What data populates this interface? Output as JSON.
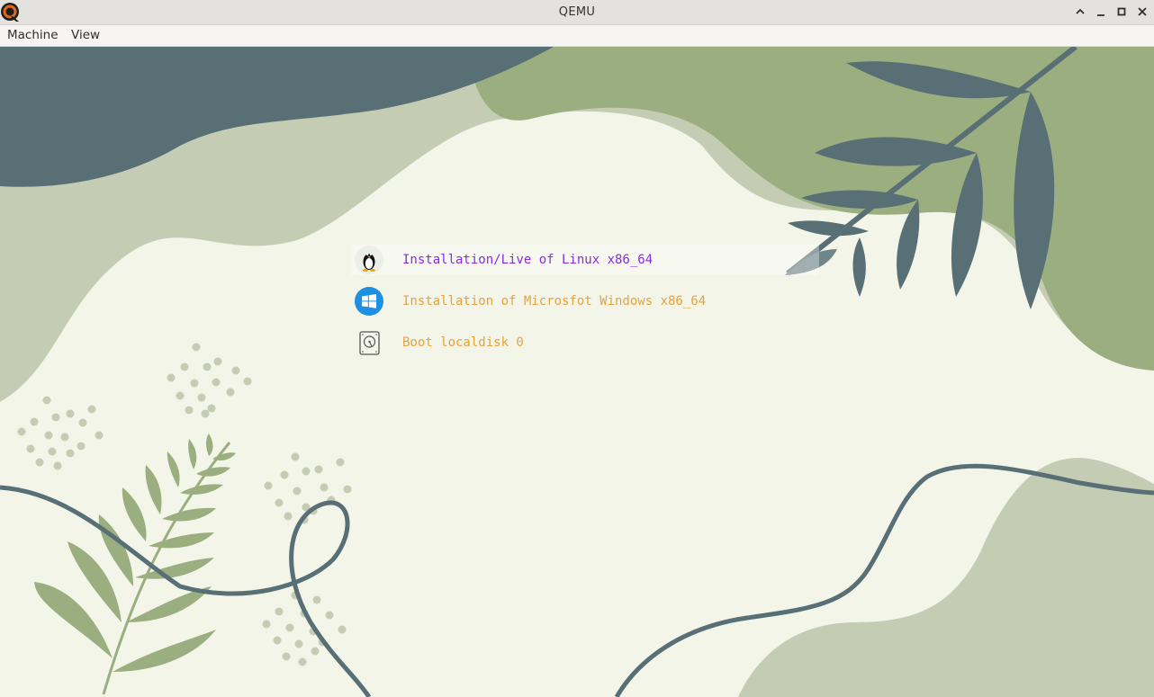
{
  "window": {
    "title": "QEMU",
    "app_icon": "qemu-logo-icon",
    "controls": [
      "minimize-up-icon",
      "minimize-icon",
      "maximize-icon",
      "close-icon"
    ]
  },
  "menubar": {
    "items": [
      {
        "label": "Machine"
      },
      {
        "label": "View"
      }
    ]
  },
  "boot_menu": {
    "entries": [
      {
        "label": "Installation/Live of Linux x86_64",
        "icon": "linux-tux-icon",
        "color": "#8a2be2",
        "selected": true
      },
      {
        "label": "Installation of Microsfot Windows x86_64",
        "icon": "windows-icon",
        "color": "#e8a23a",
        "selected": false
      },
      {
        "label": "Boot localdisk 0",
        "icon": "hard-disk-icon",
        "color": "#e8a23a",
        "selected": false
      }
    ]
  },
  "colors": {
    "background": "#f3f5e9",
    "slate": "#587075",
    "sage": "#9aae7f",
    "light_sage": "#c4ccb4",
    "selected_text": "#8a2be2",
    "normal_text": "#e8a23a"
  }
}
